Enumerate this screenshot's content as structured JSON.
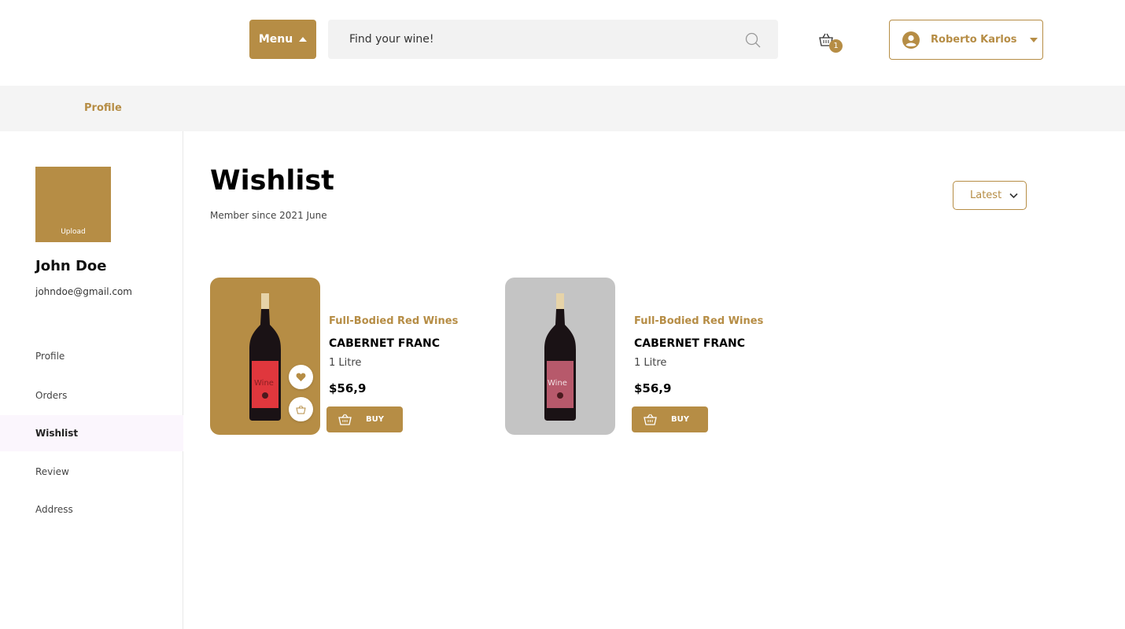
{
  "header": {
    "menu_label": "Menu",
    "search_placeholder": "Find your wine!",
    "cart_count": "1",
    "user_name": "Roberto Karlos"
  },
  "breadcrumb": {
    "current": "Profile"
  },
  "sidebar": {
    "upload_label": "Upload",
    "name": "John Doe",
    "email": "johndoe@gmail.com",
    "items": [
      {
        "label": "Profile"
      },
      {
        "label": "Orders"
      },
      {
        "label": "Wishlist"
      },
      {
        "label": "Review"
      },
      {
        "label": "Address"
      }
    ]
  },
  "main": {
    "title": "Wishlist",
    "subtitle": "Member since 2021 June",
    "sort_label": "Latest",
    "products": [
      {
        "category": "Full-Bodied Red Wines",
        "name": "CABERNET FRANC",
        "volume": "1 Litre",
        "price": "$56,9",
        "buy_label": "BUY",
        "label_text": "Wine"
      },
      {
        "category": "Full-Bodied Red Wines",
        "name": "CABERNET FRANC",
        "volume": "1 Litre",
        "price": "$56,9",
        "buy_label": "BUY",
        "label_text": "Wine"
      }
    ]
  },
  "colors": {
    "accent": "#b68d45",
    "card_gray": "#c4c4c4",
    "active_nav_bg": "#fbf6fd"
  }
}
